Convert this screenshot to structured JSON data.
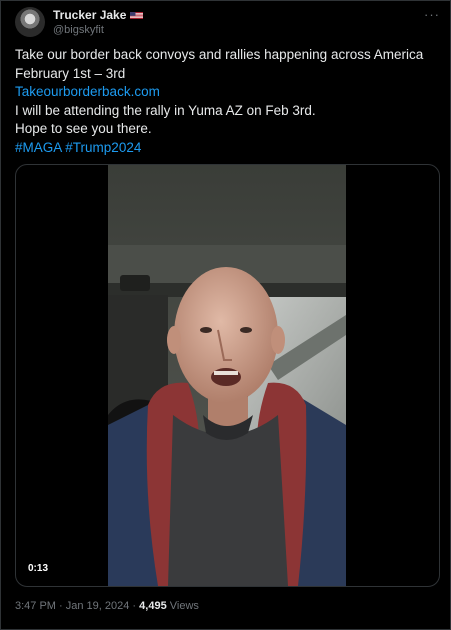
{
  "author": {
    "display_name": "Trucker Jake",
    "handle": "@bigskyfit",
    "flag_icon": "us-flag-icon"
  },
  "menu": {
    "more_label": "···"
  },
  "tweet": {
    "line1": "Take our border back convoys and rallies happening across America",
    "line2": "February 1st – 3rd",
    "link": "Takeourborderback.com",
    "line3": "I will be attending the rally in Yuma AZ on Feb 3rd.",
    "line4": "Hope to see you there.",
    "hashtag1": "#MAGA",
    "hashtag2": "#Trump2024"
  },
  "media": {
    "duration": "0:13"
  },
  "meta": {
    "time": "3:47 PM",
    "separator": " · ",
    "date": "Jan 19, 2024",
    "views_count": "4,495",
    "views_label": "Views"
  },
  "colors": {
    "link": "#1d9bf0",
    "text": "#e7e9ea",
    "muted": "#71767b",
    "background": "#000000"
  }
}
